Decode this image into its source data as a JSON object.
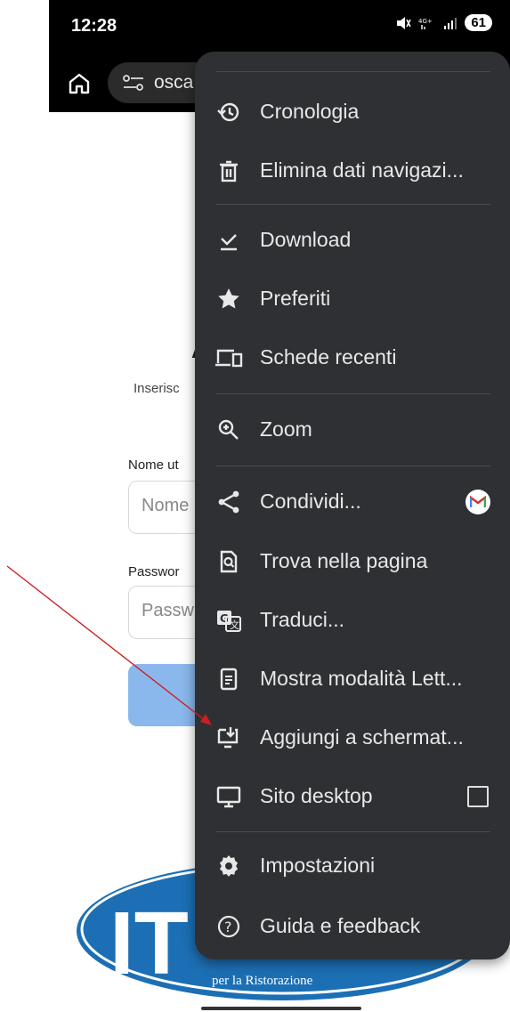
{
  "status_bar": {
    "time": "12:28",
    "battery": "61"
  },
  "toolbar": {
    "url_text": "osca"
  },
  "page": {
    "heading_partial": "A",
    "description_partial": "Inserisc",
    "username_label_partial": "Nome ut",
    "username_placeholder_partial": "Nome",
    "password_label_partial": "Passwor",
    "password_placeholder_partial": "Passw",
    "logo_text": "IT",
    "logo_tagline": "per la Ristorazione"
  },
  "menu": {
    "items": [
      {
        "label": "Cronologia",
        "icon": "history-icon"
      },
      {
        "label": "Elimina dati navigazi...",
        "icon": "trash-icon"
      },
      {
        "label": "Download",
        "icon": "download-icon"
      },
      {
        "label": "Preferiti",
        "icon": "star-icon"
      },
      {
        "label": "Schede recenti",
        "icon": "devices-icon"
      },
      {
        "label": "Zoom",
        "icon": "zoom-icon"
      },
      {
        "label": "Condividi...",
        "icon": "share-icon"
      },
      {
        "label": "Trova nella pagina",
        "icon": "find-in-page-icon"
      },
      {
        "label": "Traduci...",
        "icon": "translate-icon"
      },
      {
        "label": "Mostra modalità Lett...",
        "icon": "reader-mode-icon"
      },
      {
        "label": "Aggiungi a schermat...",
        "icon": "add-to-homescreen-icon"
      },
      {
        "label": "Sito desktop",
        "icon": "desktop-icon"
      },
      {
        "label": "Impostazioni",
        "icon": "settings-icon"
      },
      {
        "label": "Guida e feedback",
        "icon": "help-icon"
      }
    ]
  },
  "colors": {
    "menu_bg": "#2f3033",
    "menu_text": "#e8e8e8",
    "annotation_arrow": "#cc1f1f",
    "login_button": "#8ab8ec",
    "logo_blue": "#1c6fb4"
  }
}
